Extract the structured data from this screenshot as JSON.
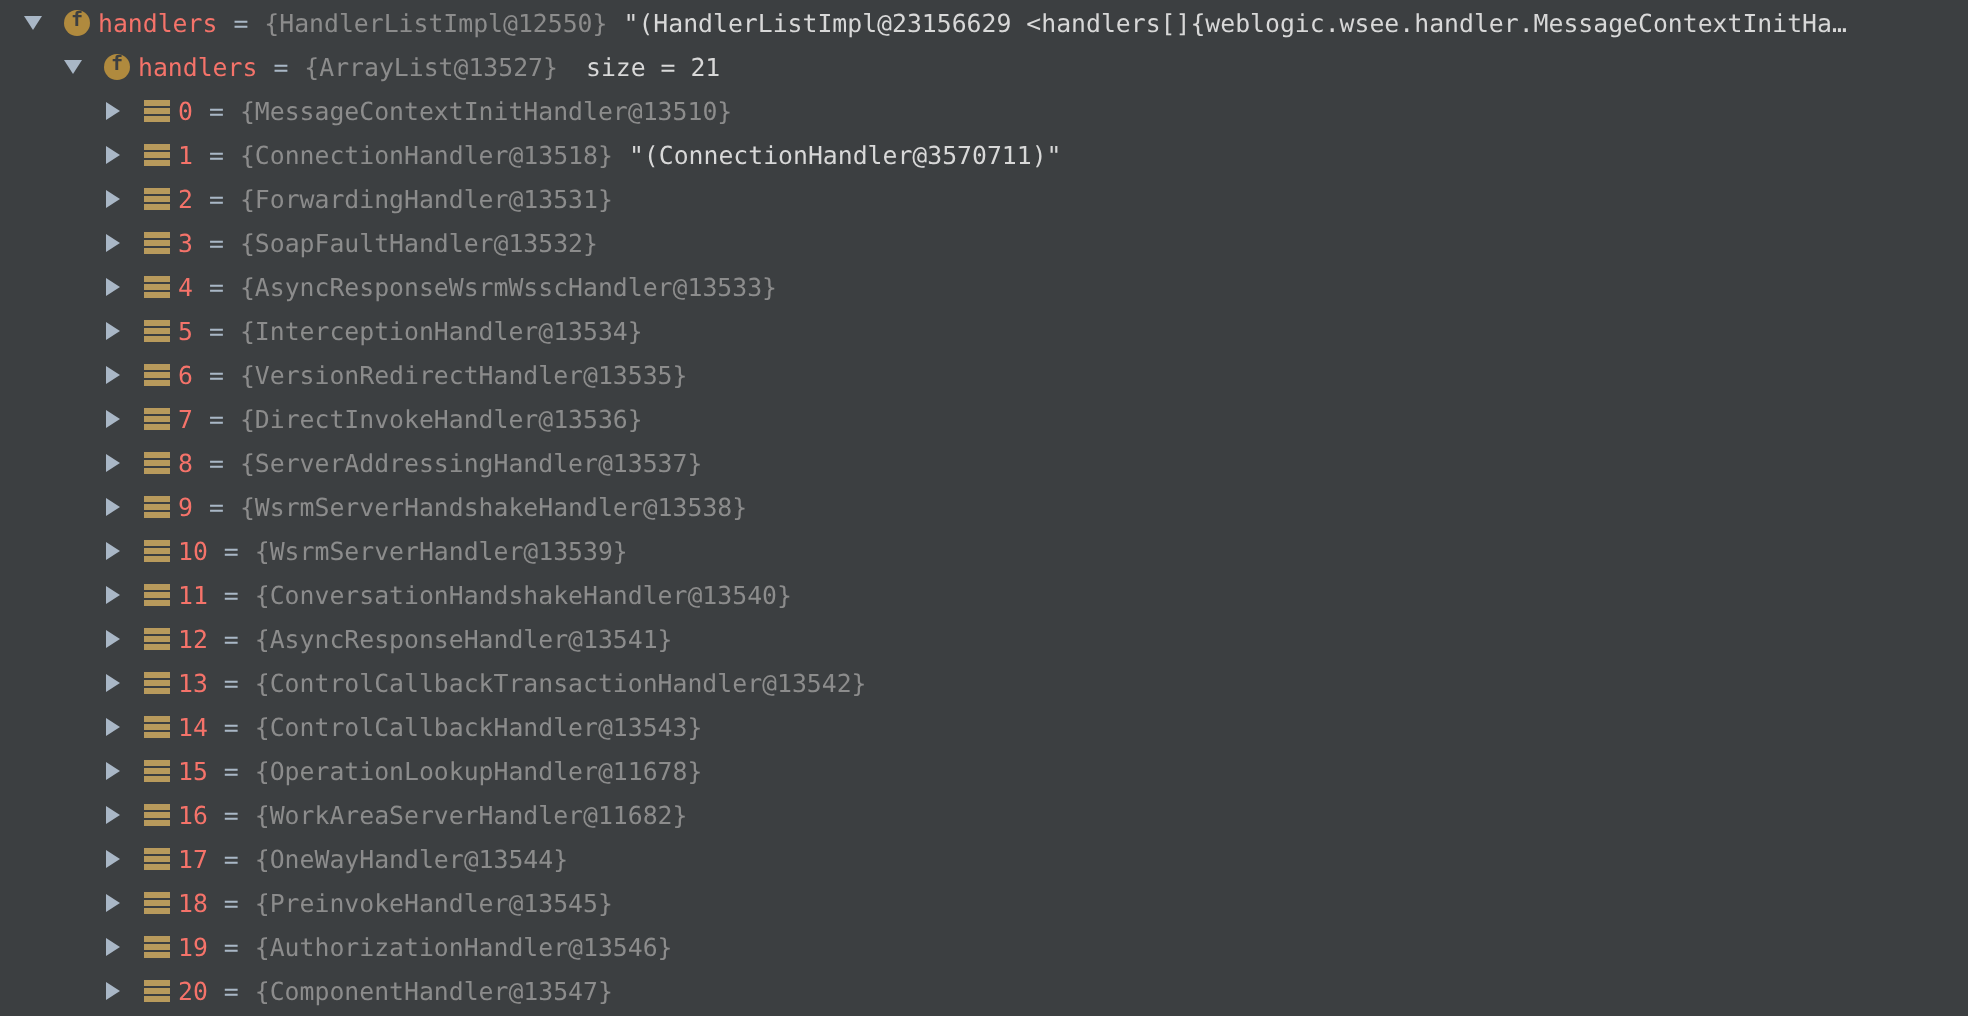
{
  "tree": [
    {
      "kind": "field",
      "badge": "f",
      "name": "handlers",
      "sep": "=",
      "type": "{HandlerListImpl@12550}",
      "value": "\"(HandlerListImpl@23156629 <handlers[]{weblogic.wsee.handler.MessageContextInitHa…",
      "expanded": true,
      "children": [
        {
          "kind": "field",
          "badge": "f",
          "name": "handlers",
          "sep": "=",
          "type": "{ArrayList@13527}",
          "extra": "size = 21",
          "expanded": true,
          "children": [
            {
              "kind": "element",
              "name": "0",
              "sep": "=",
              "type": "{MessageContextInitHandler@13510}",
              "expanded": false
            },
            {
              "kind": "element",
              "name": "1",
              "sep": "=",
              "type": "{ConnectionHandler@13518}",
              "value": "\"(ConnectionHandler@3570711)\"",
              "expanded": false
            },
            {
              "kind": "element",
              "name": "2",
              "sep": "=",
              "type": "{ForwardingHandler@13531}",
              "expanded": false
            },
            {
              "kind": "element",
              "name": "3",
              "sep": "=",
              "type": "{SoapFaultHandler@13532}",
              "expanded": false
            },
            {
              "kind": "element",
              "name": "4",
              "sep": "=",
              "type": "{AsyncResponseWsrmWsscHandler@13533}",
              "expanded": false
            },
            {
              "kind": "element",
              "name": "5",
              "sep": "=",
              "type": "{InterceptionHandler@13534}",
              "expanded": false
            },
            {
              "kind": "element",
              "name": "6",
              "sep": "=",
              "type": "{VersionRedirectHandler@13535}",
              "expanded": false
            },
            {
              "kind": "element",
              "name": "7",
              "sep": "=",
              "type": "{DirectInvokeHandler@13536}",
              "expanded": false
            },
            {
              "kind": "element",
              "name": "8",
              "sep": "=",
              "type": "{ServerAddressingHandler@13537}",
              "expanded": false
            },
            {
              "kind": "element",
              "name": "9",
              "sep": "=",
              "type": "{WsrmServerHandshakeHandler@13538}",
              "expanded": false
            },
            {
              "kind": "element",
              "name": "10",
              "sep": "=",
              "type": "{WsrmServerHandler@13539}",
              "expanded": false
            },
            {
              "kind": "element",
              "name": "11",
              "sep": "=",
              "type": "{ConversationHandshakeHandler@13540}",
              "expanded": false
            },
            {
              "kind": "element",
              "name": "12",
              "sep": "=",
              "type": "{AsyncResponseHandler@13541}",
              "expanded": false
            },
            {
              "kind": "element",
              "name": "13",
              "sep": "=",
              "type": "{ControlCallbackTransactionHandler@13542}",
              "expanded": false
            },
            {
              "kind": "element",
              "name": "14",
              "sep": "=",
              "type": "{ControlCallbackHandler@13543}",
              "expanded": false
            },
            {
              "kind": "element",
              "name": "15",
              "sep": "=",
              "type": "{OperationLookupHandler@11678}",
              "expanded": false
            },
            {
              "kind": "element",
              "name": "16",
              "sep": "=",
              "type": "{WorkAreaServerHandler@11682}",
              "expanded": false
            },
            {
              "kind": "element",
              "name": "17",
              "sep": "=",
              "type": "{OneWayHandler@13544}",
              "expanded": false
            },
            {
              "kind": "element",
              "name": "18",
              "sep": "=",
              "type": "{PreinvokeHandler@13545}",
              "expanded": false
            },
            {
              "kind": "element",
              "name": "19",
              "sep": "=",
              "type": "{AuthorizationHandler@13546}",
              "expanded": false
            },
            {
              "kind": "element",
              "name": "20",
              "sep": "=",
              "type": "{ComponentHandler@13547}",
              "expanded": false
            }
          ]
        }
      ]
    }
  ]
}
